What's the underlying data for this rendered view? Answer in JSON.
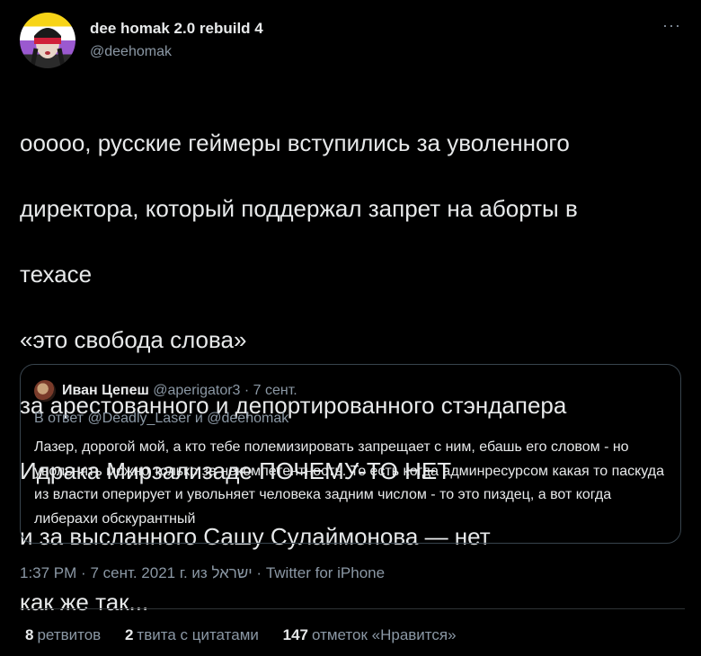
{
  "author": {
    "name": "dee homak 2.0 rebuild 4",
    "handle": "@deehomak",
    "more_label": "···"
  },
  "tweet": {
    "lines": [
      "ооооо, русские геймеры вступились за уволенного",
      "директора, который поддержал запрет на аборты в",
      "техасе",
      "«это свобода слова»",
      "за арестованного и депортированного стэндапера",
      "Идрака Мирзализаде ПОЧЕМУ-ТО НЕТ",
      "и за высланного Сашу Сулаймонова — нет",
      "как же так..."
    ]
  },
  "quote": {
    "name": "Иван Цепеш",
    "handle_date": "@aperigator3 · 7 сент.",
    "reply_to": "В ответ @Deadly_Laser и @deehomak",
    "text": "Лазер, дорогой мой, а кто тебе полемизировать запрещает с ним, ебашь его словом - но увольнять можно только за некомпетентность. То есть когда админресурсом какая то паскуда из власти оперирует и увольняет человека задним числом - то это пиздец, а вот когда либерахи обскурантный"
  },
  "meta": {
    "time": "1:37 PM",
    "date": "7 сент. 2021 г. из ישראל",
    "source": "Twitter for iPhone"
  },
  "stats": {
    "retweets_count": "8",
    "retweets_label": "ретвитов",
    "quotes_count": "2",
    "quotes_label": "твита с цитатами",
    "likes_count": "147",
    "likes_label": "отметок «Нравится»"
  }
}
